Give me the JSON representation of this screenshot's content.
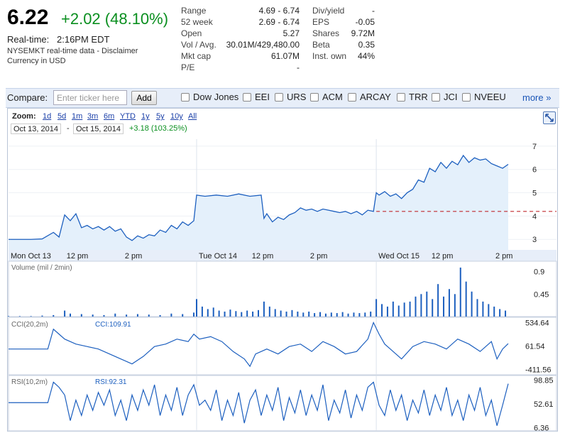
{
  "quote": {
    "price": "6.22",
    "change": "+2.02 (48.10%)",
    "realtime_label": "Real-time:",
    "realtime_time": "2:16PM EDT",
    "data_note": "NYSEMKT real-time data - Disclaimer",
    "currency_note": "Currency in USD",
    "colors": {
      "positive": "#0a8f1f"
    }
  },
  "stats_left": [
    {
      "label": "Range",
      "value": "4.69 - 6.74"
    },
    {
      "label": "52 week",
      "value": "2.69 - 6.74"
    },
    {
      "label": "Open",
      "value": "5.27"
    },
    {
      "label": "Vol / Avg.",
      "value": "30.01M/429,480.00"
    },
    {
      "label": "Mkt cap",
      "value": "61.07M"
    },
    {
      "label": "P/E",
      "value": "-"
    }
  ],
  "stats_right": [
    {
      "label": "Div/yield",
      "value": "-"
    },
    {
      "label": "EPS",
      "value": "-0.05"
    },
    {
      "label": "Shares",
      "value": "9.72M"
    },
    {
      "label": "Beta",
      "value": "0.35"
    },
    {
      "label": "Inst. own",
      "value": "44%"
    }
  ],
  "compare": {
    "label": "Compare:",
    "placeholder": "Enter ticker here",
    "add_label": "Add",
    "tickers": [
      "Dow Jones",
      "EEI",
      "URS",
      "ACM",
      "ARCAY",
      "TRR",
      "JCI",
      "NVEEU"
    ],
    "more_label": "more »"
  },
  "zoom": {
    "label": "Zoom:",
    "options": [
      "1d",
      "5d",
      "1m",
      "3m",
      "6m",
      "YTD",
      "1y",
      "5y",
      "10y",
      "All"
    ],
    "from_date": "Oct 13, 2014",
    "separator": "-",
    "to_date": "Oct 15, 2014",
    "range_change": "+3.18 (103.25%)"
  },
  "chart_data": {
    "type": "line",
    "x_labels": [
      "Mon Oct 13",
      "12 pm",
      "2 pm",
      "Tue Oct 14",
      "12 pm",
      "2 pm",
      "Wed Oct 15",
      "12 pm",
      "2 pm"
    ],
    "price": {
      "y_ticks": [
        "7",
        "6",
        "5",
        "4",
        "3"
      ],
      "previous_close": 4.2,
      "ylim": [
        2.55,
        7.3
      ],
      "series": [
        [
          0,
          3.0
        ],
        [
          2,
          3.0
        ],
        [
          4,
          3.0
        ],
        [
          6,
          3.02
        ],
        [
          8,
          3.3
        ],
        [
          9,
          3.1
        ],
        [
          10,
          4.05
        ],
        [
          11,
          3.8
        ],
        [
          12,
          4.1
        ],
        [
          13,
          3.5
        ],
        [
          14,
          3.6
        ],
        [
          15,
          3.45
        ],
        [
          16,
          3.55
        ],
        [
          17,
          3.4
        ],
        [
          18,
          3.55
        ],
        [
          19,
          3.35
        ],
        [
          20,
          3.45
        ],
        [
          21,
          3.1
        ],
        [
          22,
          2.95
        ],
        [
          23,
          3.15
        ],
        [
          24,
          3.05
        ],
        [
          25,
          3.2
        ],
        [
          26,
          3.15
        ],
        [
          27,
          3.4
        ],
        [
          28,
          3.3
        ],
        [
          29,
          3.6
        ],
        [
          30,
          3.45
        ],
        [
          31,
          3.75
        ],
        [
          32,
          3.6
        ],
        [
          33,
          3.8
        ],
        [
          33.5,
          4.9
        ],
        [
          35,
          4.85
        ],
        [
          37,
          4.9
        ],
        [
          39,
          4.85
        ],
        [
          41,
          4.95
        ],
        [
          43,
          4.85
        ],
        [
          45,
          4.9
        ],
        [
          45.5,
          3.9
        ],
        [
          46,
          4.1
        ],
        [
          47,
          3.75
        ],
        [
          48,
          3.95
        ],
        [
          49,
          3.85
        ],
        [
          50,
          4.05
        ],
        [
          51,
          4.15
        ],
        [
          52,
          4.35
        ],
        [
          53,
          4.25
        ],
        [
          54,
          4.3
        ],
        [
          55,
          4.2
        ],
        [
          56,
          4.3
        ],
        [
          57,
          4.25
        ],
        [
          58,
          4.2
        ],
        [
          59,
          4.15
        ],
        [
          60,
          4.2
        ],
        [
          61,
          4.1
        ],
        [
          62,
          4.2
        ],
        [
          63,
          4.05
        ],
        [
          64,
          4.25
        ],
        [
          65,
          4.2
        ],
        [
          65.5,
          5.0
        ],
        [
          66,
          4.9
        ],
        [
          67,
          5.05
        ],
        [
          68,
          4.85
        ],
        [
          69,
          4.95
        ],
        [
          70,
          4.75
        ],
        [
          71,
          5.0
        ],
        [
          72,
          5.15
        ],
        [
          73,
          5.55
        ],
        [
          74,
          5.45
        ],
        [
          75,
          6.05
        ],
        [
          76,
          5.9
        ],
        [
          77,
          6.3
        ],
        [
          78,
          6.05
        ],
        [
          79,
          6.35
        ],
        [
          80,
          6.2
        ],
        [
          81,
          6.6
        ],
        [
          82,
          6.3
        ],
        [
          83,
          6.5
        ],
        [
          84,
          6.4
        ],
        [
          85,
          6.45
        ],
        [
          86,
          6.25
        ],
        [
          87,
          6.15
        ],
        [
          88,
          6.05
        ],
        [
          89,
          6.22
        ]
      ]
    },
    "volume": {
      "label": "Volume (mil / 2min)",
      "y_ticks": [
        "0.9",
        "0.45"
      ],
      "ylim": [
        0,
        1.05
      ],
      "bars": [
        [
          0,
          0.01
        ],
        [
          2,
          0.01
        ],
        [
          4,
          0.01
        ],
        [
          6,
          0.02
        ],
        [
          8,
          0.03
        ],
        [
          10,
          0.12
        ],
        [
          11,
          0.06
        ],
        [
          13,
          0.05
        ],
        [
          15,
          0.04
        ],
        [
          17,
          0.03
        ],
        [
          19,
          0.06
        ],
        [
          21,
          0.04
        ],
        [
          23,
          0.05
        ],
        [
          25,
          0.04
        ],
        [
          27,
          0.03
        ],
        [
          29,
          0.06
        ],
        [
          31,
          0.05
        ],
        [
          33,
          0.08
        ],
        [
          33.5,
          0.35
        ],
        [
          34.5,
          0.2
        ],
        [
          35.5,
          0.15
        ],
        [
          36.5,
          0.18
        ],
        [
          37.5,
          0.12
        ],
        [
          38.5,
          0.1
        ],
        [
          39.5,
          0.14
        ],
        [
          40.5,
          0.11
        ],
        [
          41.5,
          0.09
        ],
        [
          42.5,
          0.12
        ],
        [
          43.5,
          0.1
        ],
        [
          44.5,
          0.13
        ],
        [
          45.5,
          0.3
        ],
        [
          46.5,
          0.2
        ],
        [
          47.5,
          0.15
        ],
        [
          48.5,
          0.12
        ],
        [
          49.5,
          0.1
        ],
        [
          50.5,
          0.13
        ],
        [
          51.5,
          0.1
        ],
        [
          52.5,
          0.08
        ],
        [
          53.5,
          0.1
        ],
        [
          54.5,
          0.07
        ],
        [
          55.5,
          0.09
        ],
        [
          56.5,
          0.06
        ],
        [
          57.5,
          0.08
        ],
        [
          58.5,
          0.07
        ],
        [
          59.5,
          0.09
        ],
        [
          60.5,
          0.06
        ],
        [
          61.5,
          0.08
        ],
        [
          62.5,
          0.07
        ],
        [
          63.5,
          0.08
        ],
        [
          64.5,
          0.1
        ],
        [
          65.5,
          0.35
        ],
        [
          66.5,
          0.25
        ],
        [
          67.5,
          0.2
        ],
        [
          68.5,
          0.3
        ],
        [
          69.5,
          0.22
        ],
        [
          70.5,
          0.28
        ],
        [
          71.5,
          0.3
        ],
        [
          72.5,
          0.4
        ],
        [
          73.5,
          0.45
        ],
        [
          74.5,
          0.5
        ],
        [
          75.5,
          0.35
        ],
        [
          76.5,
          0.65
        ],
        [
          77.5,
          0.4
        ],
        [
          78.5,
          0.55
        ],
        [
          79.5,
          0.45
        ],
        [
          80.5,
          0.98
        ],
        [
          81.5,
          0.7
        ],
        [
          82.5,
          0.5
        ],
        [
          83.5,
          0.35
        ],
        [
          84.5,
          0.3
        ],
        [
          85.5,
          0.25
        ],
        [
          86.5,
          0.2
        ],
        [
          87.5,
          0.15
        ],
        [
          88.5,
          0.12
        ]
      ]
    },
    "cci": {
      "label": "CCI(20,2m)",
      "value_label": "CCI:109.91",
      "y_ticks": [
        "534.64",
        "61.54",
        "-411.56"
      ],
      "ylim": [
        -520,
        640
      ],
      "series": [
        [
          0,
          0
        ],
        [
          4,
          0
        ],
        [
          7,
          0
        ],
        [
          8,
          400
        ],
        [
          9,
          300
        ],
        [
          10,
          200
        ],
        [
          12,
          100
        ],
        [
          14,
          50
        ],
        [
          16,
          0
        ],
        [
          18,
          -100
        ],
        [
          20,
          -200
        ],
        [
          22,
          -300
        ],
        [
          24,
          -150
        ],
        [
          26,
          50
        ],
        [
          28,
          100
        ],
        [
          30,
          200
        ],
        [
          32,
          150
        ],
        [
          33,
          300
        ],
        [
          34,
          200
        ],
        [
          36,
          250
        ],
        [
          38,
          150
        ],
        [
          40,
          -50
        ],
        [
          42,
          -200
        ],
        [
          43,
          -350
        ],
        [
          44,
          -100
        ],
        [
          46,
          0
        ],
        [
          48,
          -100
        ],
        [
          50,
          50
        ],
        [
          52,
          100
        ],
        [
          54,
          -50
        ],
        [
          56,
          150
        ],
        [
          58,
          50
        ],
        [
          60,
          -100
        ],
        [
          62,
          -50
        ],
        [
          64,
          200
        ],
        [
          65,
          534
        ],
        [
          66,
          300
        ],
        [
          67,
          100
        ],
        [
          68,
          0
        ],
        [
          70,
          -200
        ],
        [
          72,
          50
        ],
        [
          74,
          150
        ],
        [
          76,
          100
        ],
        [
          78,
          0
        ],
        [
          80,
          200
        ],
        [
          82,
          100
        ],
        [
          84,
          -50
        ],
        [
          86,
          150
        ],
        [
          87,
          -200
        ],
        [
          88,
          0
        ],
        [
          89,
          110
        ]
      ]
    },
    "rsi": {
      "label": "RSI(10,2m)",
      "value_label": "RSI:92.31",
      "y_ticks": [
        "98.85",
        "52.61",
        "6.36"
      ],
      "ylim": [
        0,
        108
      ],
      "series": [
        [
          0,
          55
        ],
        [
          4,
          55
        ],
        [
          7,
          55
        ],
        [
          8,
          95
        ],
        [
          9,
          85
        ],
        [
          10,
          70
        ],
        [
          11,
          20
        ],
        [
          12,
          60
        ],
        [
          13,
          30
        ],
        [
          14,
          70
        ],
        [
          15,
          40
        ],
        [
          16,
          75
        ],
        [
          17,
          50
        ],
        [
          18,
          80
        ],
        [
          19,
          30
        ],
        [
          20,
          60
        ],
        [
          21,
          20
        ],
        [
          22,
          70
        ],
        [
          23,
          40
        ],
        [
          24,
          80
        ],
        [
          25,
          50
        ],
        [
          26,
          90
        ],
        [
          27,
          30
        ],
        [
          28,
          70
        ],
        [
          29,
          40
        ],
        [
          30,
          85
        ],
        [
          31,
          30
        ],
        [
          32,
          70
        ],
        [
          33,
          90
        ],
        [
          34,
          50
        ],
        [
          35,
          60
        ],
        [
          36,
          40
        ],
        [
          37,
          80
        ],
        [
          38,
          20
        ],
        [
          39,
          60
        ],
        [
          40,
          30
        ],
        [
          41,
          75
        ],
        [
          42,
          15
        ],
        [
          43,
          60
        ],
        [
          44,
          80
        ],
        [
          45,
          30
        ],
        [
          46,
          70
        ],
        [
          47,
          40
        ],
        [
          48,
          85
        ],
        [
          49,
          20
        ],
        [
          50,
          65
        ],
        [
          51,
          35
        ],
        [
          52,
          80
        ],
        [
          53,
          30
        ],
        [
          54,
          70
        ],
        [
          55,
          40
        ],
        [
          56,
          90
        ],
        [
          57,
          20
        ],
        [
          58,
          60
        ],
        [
          59,
          35
        ],
        [
          60,
          80
        ],
        [
          61,
          25
        ],
        [
          62,
          70
        ],
        [
          63,
          40
        ],
        [
          64,
          85
        ],
        [
          65,
          95
        ],
        [
          66,
          50
        ],
        [
          67,
          30
        ],
        [
          68,
          80
        ],
        [
          69,
          40
        ],
        [
          70,
          70
        ],
        [
          71,
          20
        ],
        [
          72,
          60
        ],
        [
          73,
          35
        ],
        [
          74,
          80
        ],
        [
          75,
          30
        ],
        [
          76,
          70
        ],
        [
          77,
          40
        ],
        [
          78,
          85
        ],
        [
          79,
          30
        ],
        [
          80,
          60
        ],
        [
          81,
          20
        ],
        [
          82,
          70
        ],
        [
          83,
          40
        ],
        [
          84,
          85
        ],
        [
          85,
          30
        ],
        [
          86,
          60
        ],
        [
          87,
          10
        ],
        [
          88,
          50
        ],
        [
          89,
          92
        ]
      ]
    }
  }
}
